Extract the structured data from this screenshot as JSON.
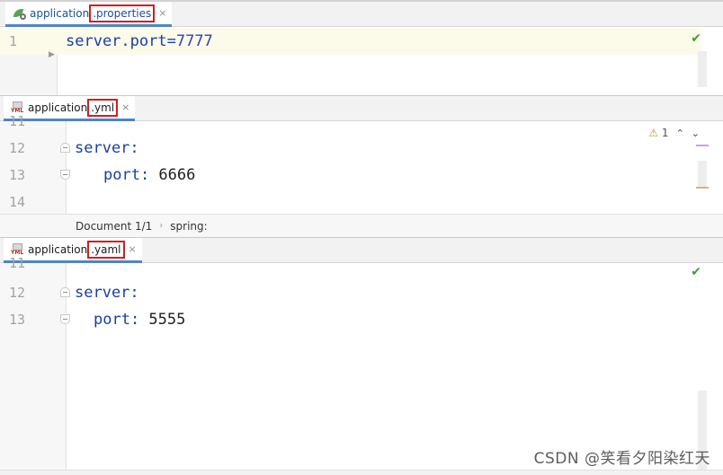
{
  "panes": [
    {
      "tab": {
        "prefix": "application",
        "highlight": ".properties",
        "icon": "spring-properties-icon"
      },
      "lines": [
        {
          "num": "1",
          "code": {
            "key": "server.port=",
            "value": "7777"
          }
        }
      ],
      "status": "check"
    },
    {
      "tab": {
        "prefix": "application",
        "highlight": ".yml",
        "icon": "yml-file-icon"
      },
      "lines": [
        {
          "num": "11",
          "text": ""
        },
        {
          "num": "12",
          "key": "server:",
          "value": ""
        },
        {
          "num": "13",
          "key": "port:",
          "value": " 6666"
        },
        {
          "num": "14",
          "text": ""
        }
      ],
      "warnings_count": "1",
      "breadcrumb": {
        "doc": "Document 1/1",
        "path": "spring:"
      }
    },
    {
      "tab": {
        "prefix": "application",
        "highlight": ".yaml",
        "icon": "yml-file-icon"
      },
      "lines": [
        {
          "num": "11",
          "text": ""
        },
        {
          "num": "12",
          "key": "server:",
          "value": ""
        },
        {
          "num": "13",
          "key": "port:",
          "value": " 5555"
        }
      ],
      "status": "check"
    }
  ],
  "icons": {
    "close": "×",
    "check": "✔",
    "warning": "⚠",
    "chevron_up": "⌃",
    "chevron_down": "⌄",
    "yml_label": "YML"
  },
  "watermark": "CSDN @笑看夕阳染红天"
}
